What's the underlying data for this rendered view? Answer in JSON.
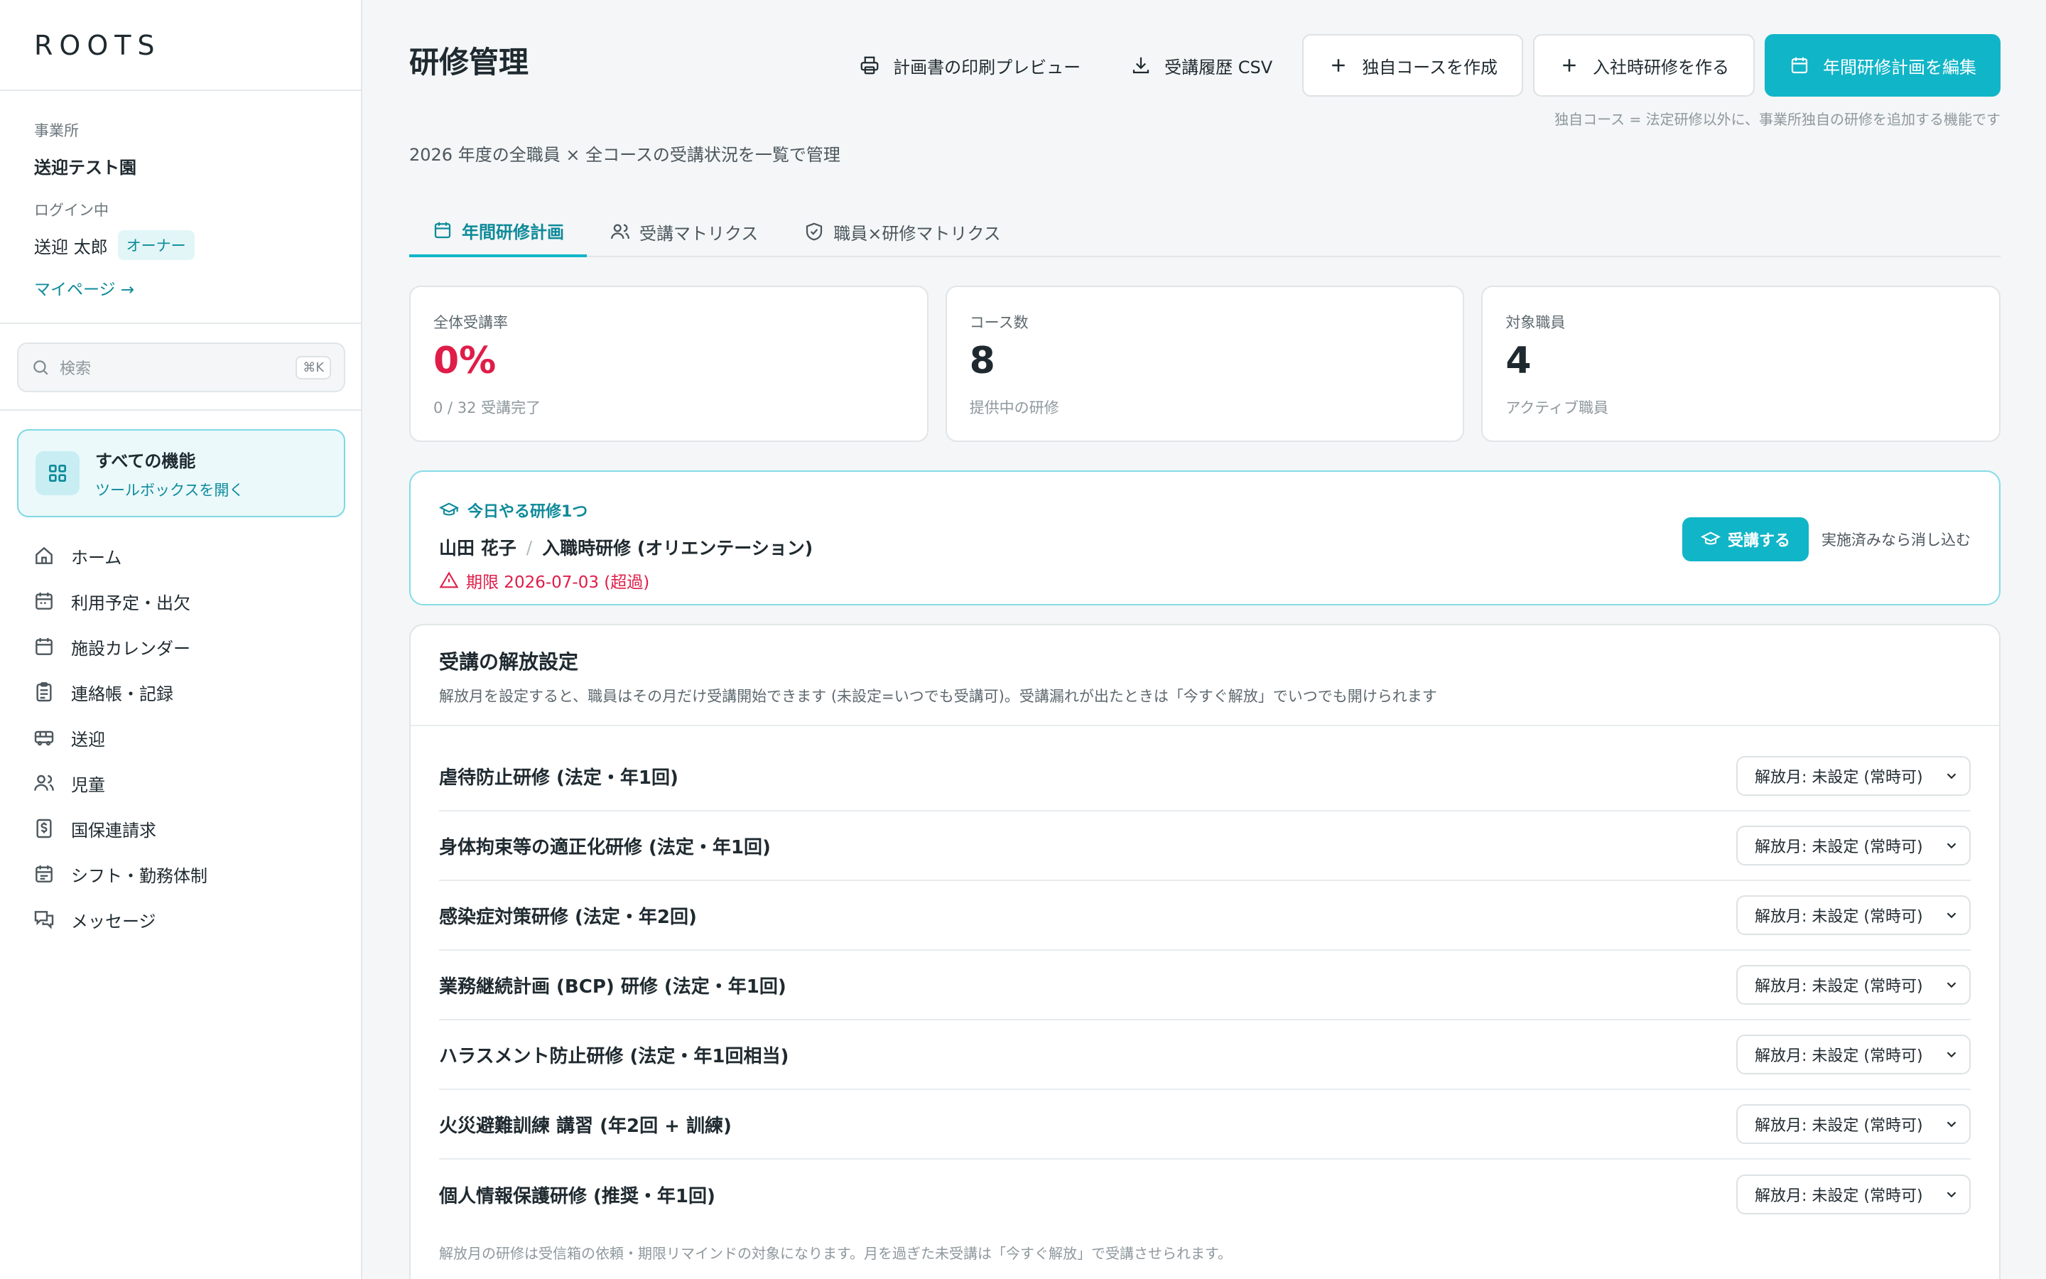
{
  "sidebar": {
    "logo": "ROOTS",
    "facility_label": "事業所",
    "facility_name": "送迎テスト園",
    "login_label": "ログイン中",
    "user_name": "送迎 太郎",
    "role_badge": "オーナー",
    "mypage_link": "マイページ →",
    "search_placeholder": "検索",
    "search_shortcut": "⌘K",
    "all_features_title": "すべての機能",
    "all_features_sub": "ツールボックスを開く",
    "nav": [
      {
        "label": "ホーム",
        "icon": "home-icon"
      },
      {
        "label": "利用予定・出欠",
        "icon": "calendar-icon"
      },
      {
        "label": "施設カレンダー",
        "icon": "calendar-grid-icon"
      },
      {
        "label": "連絡帳・記録",
        "icon": "clipboard-icon"
      },
      {
        "label": "送迎",
        "icon": "bus-icon"
      },
      {
        "label": "児童",
        "icon": "users-icon"
      },
      {
        "label": "国保連請求",
        "icon": "dollar-doc-icon"
      },
      {
        "label": "シフト・勤務体制",
        "icon": "schedule-icon"
      },
      {
        "label": "メッセージ",
        "icon": "messages-icon"
      }
    ]
  },
  "header": {
    "title": "研修管理",
    "subtitle": "2026 年度の全職員 × 全コースの受講状況を一覧で管理",
    "print_preview": "計画書の印刷プレビュー",
    "export_csv": "受講履歴 CSV",
    "create_custom": "独自コースを作成",
    "create_onboarding": "入社時研修を作る",
    "edit_plan": "年間研修計画を編集",
    "toolbar_note": "独自コース = 法定研修以外に、事業所独自の研修を追加する機能です"
  },
  "tabs": [
    {
      "label": "年間研修計画",
      "icon": "calendar-icon",
      "active": true
    },
    {
      "label": "受講マトリクス",
      "icon": "users-icon",
      "active": false
    },
    {
      "label": "職員×研修マトリクス",
      "icon": "shield-check-icon",
      "active": false
    }
  ],
  "stats": [
    {
      "label": "全体受講率",
      "value": "0%",
      "sub": "0 / 32 受講完了"
    },
    {
      "label": "コース数",
      "value": "8",
      "sub": "提供中の研修"
    },
    {
      "label": "対象職員",
      "value": "4",
      "sub": "アクティブ職員"
    }
  ],
  "today": {
    "heading": "今日やる研修1つ",
    "staff": "山田 花子",
    "separator": "/",
    "course": "入職時研修 (オリエンテーション)",
    "deadline": "期限 2026-07-03 (超過)",
    "take_button": "受講する",
    "dismiss": "実施済みなら消し込む"
  },
  "release": {
    "title": "受講の解放設定",
    "description": "解放月を設定すると、職員はその月だけ受講開始できます (未設定=いつでも受講可)。受講漏れが出たときは「今すぐ解放」でいつでも開けられます",
    "courses": [
      {
        "name": "虐待防止研修 (法定・年1回)",
        "release": "解放月: 未設定 (常時可)"
      },
      {
        "name": "身体拘束等の適正化研修 (法定・年1回)",
        "release": "解放月: 未設定 (常時可)"
      },
      {
        "name": "感染症対策研修 (法定・年2回)",
        "release": "解放月: 未設定 (常時可)"
      },
      {
        "name": "業務継続計画 (BCP) 研修 (法定・年1回)",
        "release": "解放月: 未設定 (常時可)"
      },
      {
        "name": "ハラスメント防止研修 (法定・年1回相当)",
        "release": "解放月: 未設定 (常時可)"
      },
      {
        "name": "火災避難訓練 講習 (年2回 + 訓練)",
        "release": "解放月: 未設定 (常時可)"
      },
      {
        "name": "個人情報保護研修 (推奨・年1回)",
        "release": "解放月: 未設定 (常時可)"
      }
    ],
    "note": "解放月の研修は受信箱の依頼・期限リマインドの対象になります。月を過ぎた未受講は「今すぐ解放」で受講させられます。"
  },
  "colors": {
    "accent": "#11b5c8",
    "accent_text": "#0e8a9a",
    "danger": "#df1d48"
  }
}
